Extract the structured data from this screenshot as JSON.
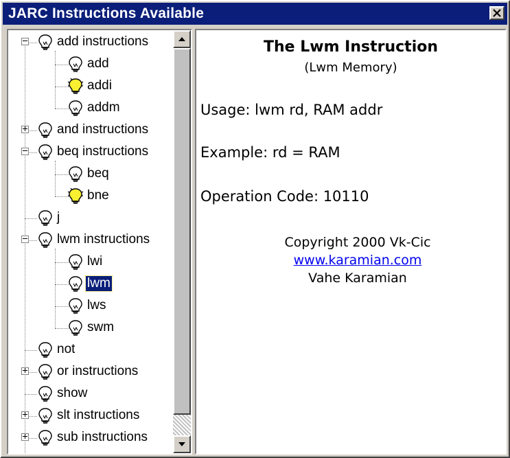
{
  "window": {
    "title": "JARC Instructions Available"
  },
  "tree": [
    {
      "label": "add instructions",
      "level": 0,
      "expander": "minus",
      "bulb": "off"
    },
    {
      "label": "add",
      "level": 1,
      "bulb": "off"
    },
    {
      "label": "addi",
      "level": 1,
      "bulb": "on"
    },
    {
      "label": "addm",
      "level": 1,
      "bulb": "off"
    },
    {
      "label": "and instructions",
      "level": 0,
      "expander": "plus",
      "bulb": "off"
    },
    {
      "label": "beq instructions",
      "level": 0,
      "expander": "minus",
      "bulb": "off"
    },
    {
      "label": "beq",
      "level": 1,
      "bulb": "off"
    },
    {
      "label": "bne",
      "level": 1,
      "bulb": "on"
    },
    {
      "label": "j",
      "level": 0,
      "bulb": "off"
    },
    {
      "label": "lwm instructions",
      "level": 0,
      "expander": "minus",
      "bulb": "off"
    },
    {
      "label": "lwi",
      "level": 1,
      "bulb": "off"
    },
    {
      "label": "lwm",
      "level": 1,
      "bulb": "off",
      "selected": true
    },
    {
      "label": "lws",
      "level": 1,
      "bulb": "off"
    },
    {
      "label": "swm",
      "level": 1,
      "bulb": "off"
    },
    {
      "label": "not",
      "level": 0,
      "bulb": "off"
    },
    {
      "label": "or instructions",
      "level": 0,
      "expander": "plus",
      "bulb": "off"
    },
    {
      "label": "show",
      "level": 0,
      "bulb": "off"
    },
    {
      "label": "slt instructions",
      "level": 0,
      "expander": "plus",
      "bulb": "off"
    },
    {
      "label": "sub instructions",
      "level": 0,
      "expander": "plus",
      "bulb": "off"
    }
  ],
  "content": {
    "title": "The Lwm Instruction",
    "subtitle": "(Lwm Memory)",
    "usage": "Usage: lwm rd, RAM addr",
    "example": "Example: rd = RAM",
    "opcode": "Operation Code: 10110",
    "copyright": "Copyright 2000 Vk-Cic",
    "link": "www.karamian.com",
    "author": "Vahe Karamian"
  },
  "icons": {
    "close": "close-icon",
    "bulb_off": "lightbulb-off-icon",
    "bulb_on": "lightbulb-on-icon",
    "scroll_up": "scroll-up-arrow-icon",
    "scroll_down": "scroll-down-arrow-icon"
  },
  "colors": {
    "titlebar": "#0a1e7a",
    "selection": "#0a1e7a",
    "bulb_on": "#f8f030",
    "link": "#0000ee"
  }
}
